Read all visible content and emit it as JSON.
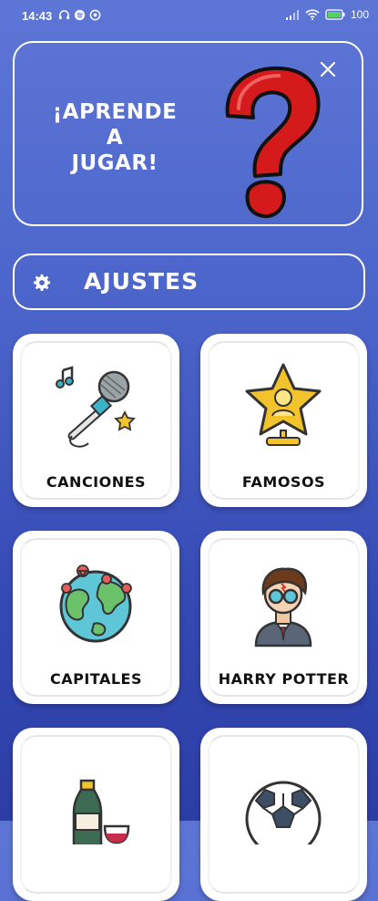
{
  "status_bar": {
    "time": "14:43",
    "battery": "100"
  },
  "learn_card": {
    "title_lines": [
      "¡APRENDE",
      "A",
      "JUGAR!"
    ]
  },
  "settings": {
    "label": "AJUSTES"
  },
  "categories": [
    {
      "label": "CANCIONES",
      "icon": "microphone-icon"
    },
    {
      "label": "FAMOSOS",
      "icon": "star-trophy-icon"
    },
    {
      "label": "CAPITALES",
      "icon": "globe-icon"
    },
    {
      "label": "HARRY POTTER",
      "icon": "wizard-icon"
    },
    {
      "label": "",
      "icon": "bottle-wine-icon"
    },
    {
      "label": "",
      "icon": "soccer-ball-icon"
    }
  ],
  "colors": {
    "background_top": "#5d76d6",
    "background_bottom": "#2c3ea6",
    "question_mark": "#d41a1a",
    "card": "#ffffff"
  }
}
